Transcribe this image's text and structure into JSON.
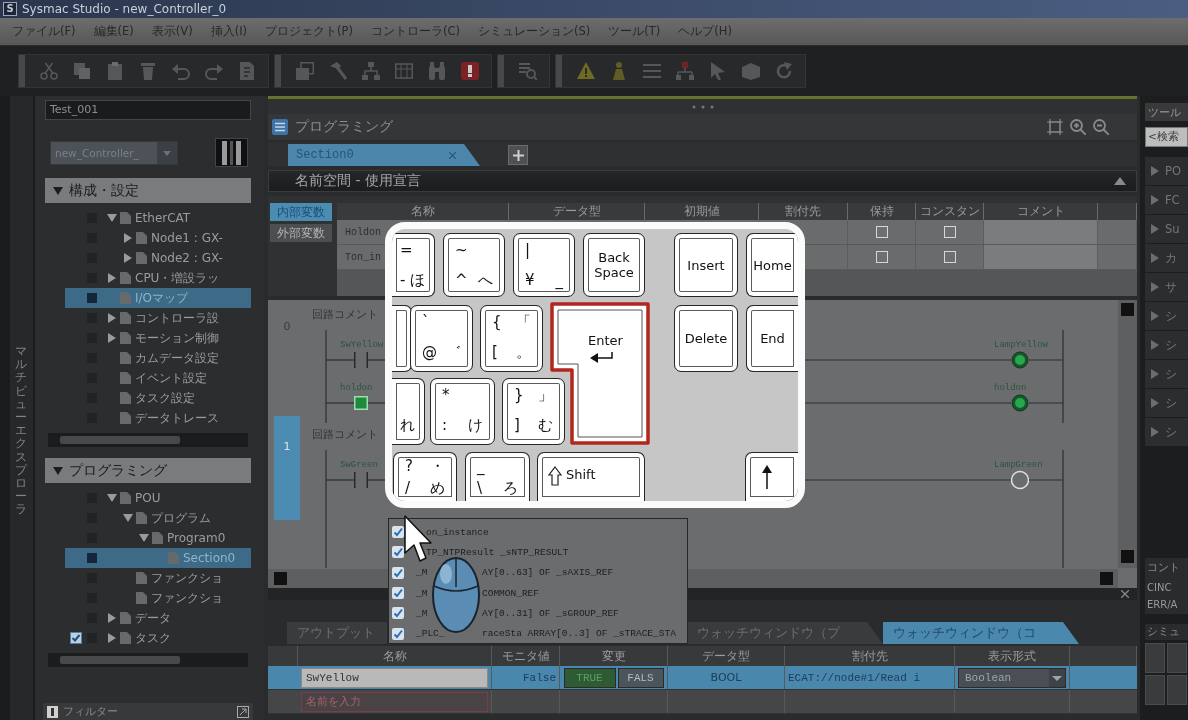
{
  "window": {
    "icon_letter": "S",
    "title": "Sysmac Studio - new_Controller_0"
  },
  "menu": [
    {
      "label": "ファイル(F)"
    },
    {
      "label": "編集(E)"
    },
    {
      "label": "表示(V)"
    },
    {
      "label": "挿入(I)"
    },
    {
      "label": "プロジェクト(P)"
    },
    {
      "label": "コントローラ(C)"
    },
    {
      "label": "シミュレーション(S)"
    },
    {
      "label": "ツール(T)"
    },
    {
      "label": "ヘルプ(H)"
    }
  ],
  "side_tab": {
    "label": "マルチビューエクスプローラ"
  },
  "explorer": {
    "title": "Test_001",
    "controller": "new_Controller_",
    "sections": [
      {
        "label": "構成・設定",
        "expanded": true,
        "items": [
          {
            "label": "EtherCAT",
            "expanded": true,
            "selected": false,
            "checked": false,
            "children": [
              {
                "label": "Node1 : GX-",
                "expanded": false,
                "selected": false,
                "checked": false
              },
              {
                "label": "Node2 : GX-",
                "expanded": false,
                "selected": false,
                "checked": false
              }
            ]
          },
          {
            "label": "CPU・増設ラッ",
            "expanded": false,
            "selected": false,
            "checked": false
          },
          {
            "label": "I/Oマップ",
            "selected": true,
            "checked": false
          },
          {
            "label": "コントローラ設",
            "expanded": false,
            "selected": false,
            "checked": false
          },
          {
            "label": "モーション制御",
            "expanded": false,
            "selected": false,
            "checked": false
          },
          {
            "label": "カムデータ設定",
            "selected": false,
            "checked": false
          },
          {
            "label": "イベント設定",
            "selected": false,
            "checked": false
          },
          {
            "label": "タスク設定",
            "selected": false,
            "checked": false
          },
          {
            "label": "データトレース",
            "selected": false,
            "checked": false
          }
        ]
      },
      {
        "label": "プログラミング",
        "expanded": true,
        "items": [
          {
            "label": "POU",
            "expanded": true,
            "selected": false,
            "checked": false,
            "children": [
              {
                "label": "プログラム",
                "expanded": true,
                "selected": false,
                "checked": false,
                "children": [
                  {
                    "label": "Program0",
                    "expanded": true,
                    "selected": false,
                    "checked": false,
                    "children": [
                      {
                        "label": "Section0",
                        "selected": true,
                        "checked": false
                      }
                    ]
                  }
                ]
              },
              {
                "label": "ファンクショ",
                "selected": false,
                "checked": false
              },
              {
                "label": "ファンクショ",
                "selected": false,
                "checked": false
              }
            ]
          },
          {
            "label": "データ",
            "expanded": false,
            "selected": false,
            "checked": false
          },
          {
            "label": "タスク",
            "expanded": false,
            "selected": false,
            "checked": true
          }
        ]
      }
    ],
    "filter": {
      "label": "フィルター"
    }
  },
  "programming": {
    "title": "プログラミング",
    "tabs": [
      {
        "label": "Section0",
        "selected": true
      }
    ],
    "namespace_bar": {
      "label": "名前空間 - 使用宣言",
      "expanded": true
    },
    "variable_kinds": [
      {
        "label": "内部変数",
        "selected": true
      },
      {
        "label": "外部変数",
        "selected": false
      }
    ],
    "variable_table": {
      "columns": [
        "名称",
        "データ型",
        "初期値",
        "割付先",
        "保持",
        "コンスタン",
        "コメント"
      ],
      "rows": [
        {
          "name": "Holdon",
          "retain": false,
          "constant": false
        },
        {
          "name": "Ton_in",
          "retain": false,
          "constant": false
        }
      ]
    },
    "ladder": {
      "rungs": [
        {
          "number": "0",
          "selected": false,
          "comment": "回路コメント",
          "contacts": [
            {
              "variable": "SwYellow",
              "on": false
            },
            {
              "variable": "holdon",
              "on": true
            }
          ],
          "coils": [
            {
              "variable": "LampYellow",
              "on": true
            },
            {
              "variable": "holdon",
              "on": true
            }
          ]
        },
        {
          "number": "1",
          "selected": true,
          "comment": "回路コメント",
          "contacts": [
            {
              "variable": "SwGreen",
              "on": false
            }
          ],
          "coils": [
            {
              "variable": "LampGreen",
              "on": false
            }
          ]
        }
      ]
    }
  },
  "keyboard": {
    "keys": [
      {
        "kind": "kana",
        "top": "=",
        "bottom": "- ほ",
        "highlighted": false
      },
      {
        "kind": "kana",
        "top": "~",
        "bottom": "^ へ",
        "highlighted": false
      },
      {
        "kind": "kana",
        "top": "|",
        "bottom": "¥ _",
        "highlighted": false
      },
      {
        "kind": "label",
        "label": "Back Space",
        "highlighted": false
      },
      {
        "kind": "label",
        "label": "Insert",
        "highlighted": false
      },
      {
        "kind": "label",
        "label": "Home",
        "highlighted": false
      },
      {
        "kind": "blank",
        "highlighted": false
      },
      {
        "kind": "kana",
        "top": "`",
        "bottom": "@ ゛",
        "highlighted": false
      },
      {
        "kind": "kana",
        "top": "{ 「",
        "bottom": "[ 。",
        "highlighted": false
      },
      {
        "kind": "enter",
        "label": "Enter",
        "highlighted": true
      },
      {
        "kind": "label",
        "label": "Delete",
        "highlighted": false
      },
      {
        "kind": "label",
        "label": "End",
        "highlighted": false
      },
      {
        "kind": "kana",
        "bottom": "れ",
        "highlighted": false
      },
      {
        "kind": "kana",
        "top": "*",
        "bottom": ": け",
        "highlighted": false
      },
      {
        "kind": "kana",
        "top": "} 」",
        "bottom": "] む",
        "highlighted": false
      },
      {
        "kind": "kana",
        "top": "? ・",
        "bottom": "/ め",
        "highlighted": false
      },
      {
        "kind": "kana",
        "top": "_",
        "bottom": "\\ ろ",
        "highlighted": false
      },
      {
        "kind": "shift",
        "label": "Shift",
        "highlighted": false
      },
      {
        "kind": "arrow",
        "highlighted": false
      }
    ]
  },
  "completion_list": {
    "items": [
      {
        "text": "on_instance"
      },
      {
        "text": "TP_NTPResult _sNTP_RESULT"
      },
      {
        "lead": "_M",
        "text": "AY[0..63] OF _sAXIS_REF"
      },
      {
        "lead": "_M",
        "text": "COMMON_REF"
      },
      {
        "lead": "_M",
        "text": "AY[0..31] OF _sGROUP_REF"
      },
      {
        "lead": "_PLC_",
        "text": "raceSta ARRAY[0..3] OF _sTRACE_STA"
      }
    ]
  },
  "bottom_panel": {
    "tabs": [
      {
        "label": "アウトプット",
        "selected": false
      },
      {
        "label": "ウォッチウィンドウ（プ",
        "selected": false
      },
      {
        "label": "ウォッチウィンドウ（コ",
        "selected": true
      }
    ],
    "watch_table": {
      "columns": [
        "名称",
        "モニタ値",
        "変更",
        "データ型",
        "割付先",
        "表示形式"
      ],
      "rows": [
        {
          "name": "SwYellow",
          "value": "False",
          "true_button": "TRUE",
          "false_button": "FALS",
          "data_type": "BOOL",
          "address": "ECAT://node#1/Read i",
          "format": "Boolean",
          "selected": true
        }
      ],
      "new_row": {
        "placeholder": "名前を入力"
      }
    }
  },
  "toolbox": {
    "title": "ツール",
    "search": {
      "placeholder": "<検索"
    },
    "groups": [
      {
        "label": "PO",
        "expanded": false
      },
      {
        "label": "FC",
        "expanded": false
      },
      {
        "label": "Su",
        "expanded": false
      },
      {
        "label": "カ",
        "expanded": false
      },
      {
        "label": "サ",
        "expanded": false
      },
      {
        "label": "シ",
        "expanded": false
      },
      {
        "label": "シ",
        "expanded": false
      },
      {
        "label": "シ",
        "expanded": false
      },
      {
        "label": "シ",
        "expanded": false
      },
      {
        "label": "シ",
        "expanded": false
      }
    ],
    "status_panel": {
      "title": "コント",
      "lines": [
        {
          "text": "CINC"
        },
        {
          "text": "ERR/A"
        }
      ]
    },
    "simulation_panel": {
      "title": "シミュ"
    }
  }
}
